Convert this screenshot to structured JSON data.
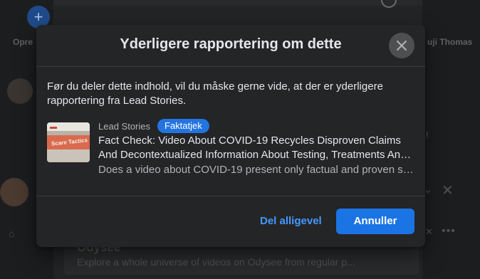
{
  "background": {
    "create_label": "Opre",
    "right_label": "uji Thomas",
    "right_fragment": "!",
    "card_title": "Odysee",
    "card_text": "Explore a whole universe of videos on Odysee from regular p..."
  },
  "dialog": {
    "title": "Yderligere rapportering om dette",
    "intro": "Før du deler dette indhold, vil du måske gerne vide, at der er yderligere rapportering fra Lead Stories.",
    "article": {
      "source": "Lead Stories",
      "badge": "Faktatjek",
      "title": "Fact Check: Video About COVID-19 Recycles Disproven Claims And Decontextualized Information About Testing, Treatments An…",
      "description": "Does a video about COVID-19 present only factual and proven s…",
      "thumbnail_text": "Scare Tactics"
    },
    "buttons": {
      "share_anyway": "Del alligevel",
      "cancel": "Annuller"
    }
  },
  "colors": {
    "primary": "#1b74e4",
    "badge": "#2374e1",
    "link": "#4599ff",
    "modal_bg": "#242526"
  },
  "icons": {
    "close": "close-icon",
    "create": "plus-icon"
  }
}
